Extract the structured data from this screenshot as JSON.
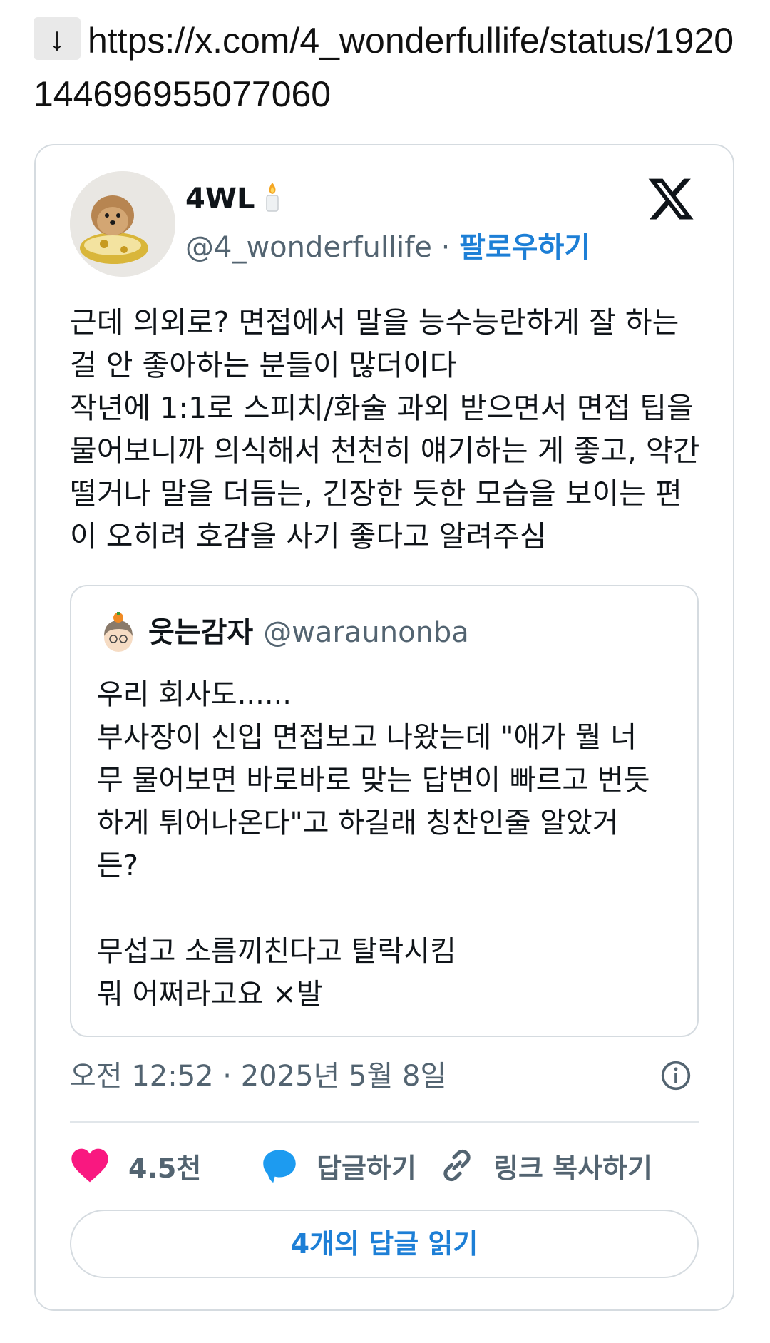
{
  "link": {
    "arrow": "↓",
    "url": "https://x.com/4_wonderfullife/status/1920144696955077060"
  },
  "tweet": {
    "display_name": "4WL",
    "handle": "@4_wonderfullife",
    "separator": "·",
    "follow_label": "팔로우하기",
    "text": "근데 의외로? 면접에서 말을 능수능란하게 잘 하는\n걸 안 좋아하는 분들이 많더이다\n작년에 1:1로 스피치/화술 과외 받으면서 면접 팁을\n물어보니까 의식해서 천천히 얘기하는 게 좋고, 약간\n떨거나 말을 더듬는, 긴장한 듯한 모습을 보이는 편\n이 오히려 호감을 사기 좋다고 알려주심",
    "timestamp": "오전 12:52 · 2025년 5월 8일"
  },
  "quote": {
    "display_name": "웃는감자",
    "handle": "@waraunonba",
    "text": "우리 회사도......\n부사장이 신입 면접보고 나왔는데 \"애가 뭘 너\n무 물어보면 바로바로 맞는 답변이 빠르고 번듯\n하게 튀어나온다\"고 하길래 칭찬인줄 알았거\n든?\n\n무섭고 소름끼친다고 탈락시킴\n뭐 어쩌라고요 ×발"
  },
  "actions": {
    "like_count": "4.5천",
    "reply_label": "답글하기",
    "copy_link_label": "링크 복사하기",
    "read_replies_label": "4개의 답글 읽기"
  },
  "colors": {
    "accent": "#1d7fd6",
    "like": "#f91880",
    "reply": "#1d9bf0",
    "muted": "#536471",
    "border": "#d5dbe0"
  }
}
